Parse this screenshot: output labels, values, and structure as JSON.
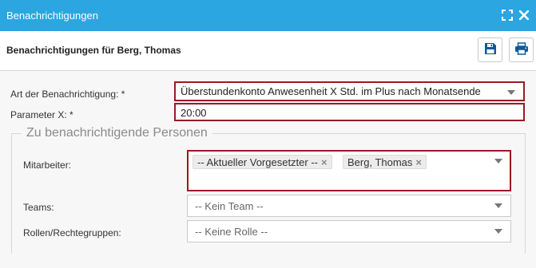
{
  "window": {
    "title": "Benachrichtigungen",
    "icons": {
      "maximize": "maximize-icon",
      "close": "close-icon"
    },
    "accent": "#2ba6e0"
  },
  "header": {
    "title": "Benachrichtigungen für Berg, Thomas",
    "buttons": {
      "save": "save-icon",
      "print": "print-icon"
    },
    "button_icon_color": "#0b5b9a"
  },
  "form": {
    "notification_type": {
      "label": "Art der Benachrichtigung: *",
      "value": "Überstundenkonto Anwesenheit X Std. im Plus nach Monatsende"
    },
    "parameter": {
      "label": "Parameter X: *",
      "value": "20:00"
    },
    "persons_group": {
      "legend": "Zu benachrichtigende Personen",
      "employees": {
        "label": "Mitarbeiter:",
        "tags": [
          {
            "text": "-- Aktueller Vorgesetzter --"
          },
          {
            "text": "Berg, Thomas"
          }
        ],
        "remove_symbol": "×"
      },
      "teams": {
        "label": "Teams:",
        "placeholder": "-- Kein Team --"
      },
      "roles": {
        "label": "Rollen/Rechtegruppen:",
        "placeholder": "-- Keine Rolle --"
      }
    },
    "required_border_color": "#9a1b22"
  }
}
